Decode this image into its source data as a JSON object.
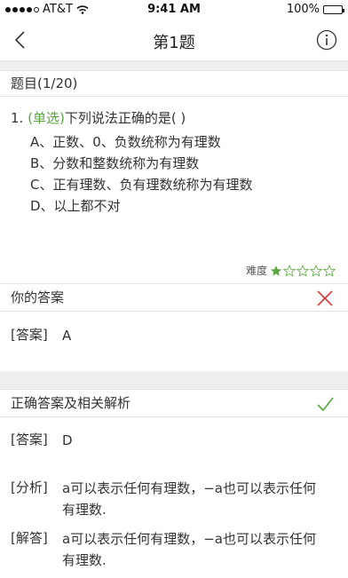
{
  "status_bar": {
    "carrier": "AT&T",
    "time": "9:41 AM",
    "battery": "100%"
  },
  "nav": {
    "title": "第1题"
  },
  "progress": {
    "label": "题目(1/20)"
  },
  "question": {
    "number": "1.",
    "type": "(单选)",
    "text": "下列说法正确的是(  )",
    "options": [
      "A、正数、0、负数统称为有理数",
      "B、分数和整数统称为有理数",
      "C、正有理数、负有理数统称为有理数",
      "D、以上都不对"
    ]
  },
  "difficulty": {
    "label": "难度",
    "rating": 1,
    "max": 5
  },
  "your_answer": {
    "header": "你的答案",
    "tag": "[答案]",
    "value": "A",
    "status_color": "#d83a3a"
  },
  "correct": {
    "header": "正确答案及相关解析",
    "answer_tag": "[答案]",
    "answer_value": "D",
    "analysis_tag": "[分析]",
    "analysis_text": "a可以表示任何有理数，−a也可以表示任何有理数.",
    "solution_tag": "[解答]",
    "solution_text": "a可以表示任何有理数，−a也可以表示任何有理数.",
    "status_color": "#5aa63f"
  },
  "colors": {
    "accent_green": "#5aa63f",
    "wrong_red": "#d83a3a"
  },
  "icons": [
    "back-chevron-icon",
    "info-icon",
    "star-icon",
    "cross-icon",
    "check-icon",
    "wifi-icon",
    "battery-icon"
  ]
}
